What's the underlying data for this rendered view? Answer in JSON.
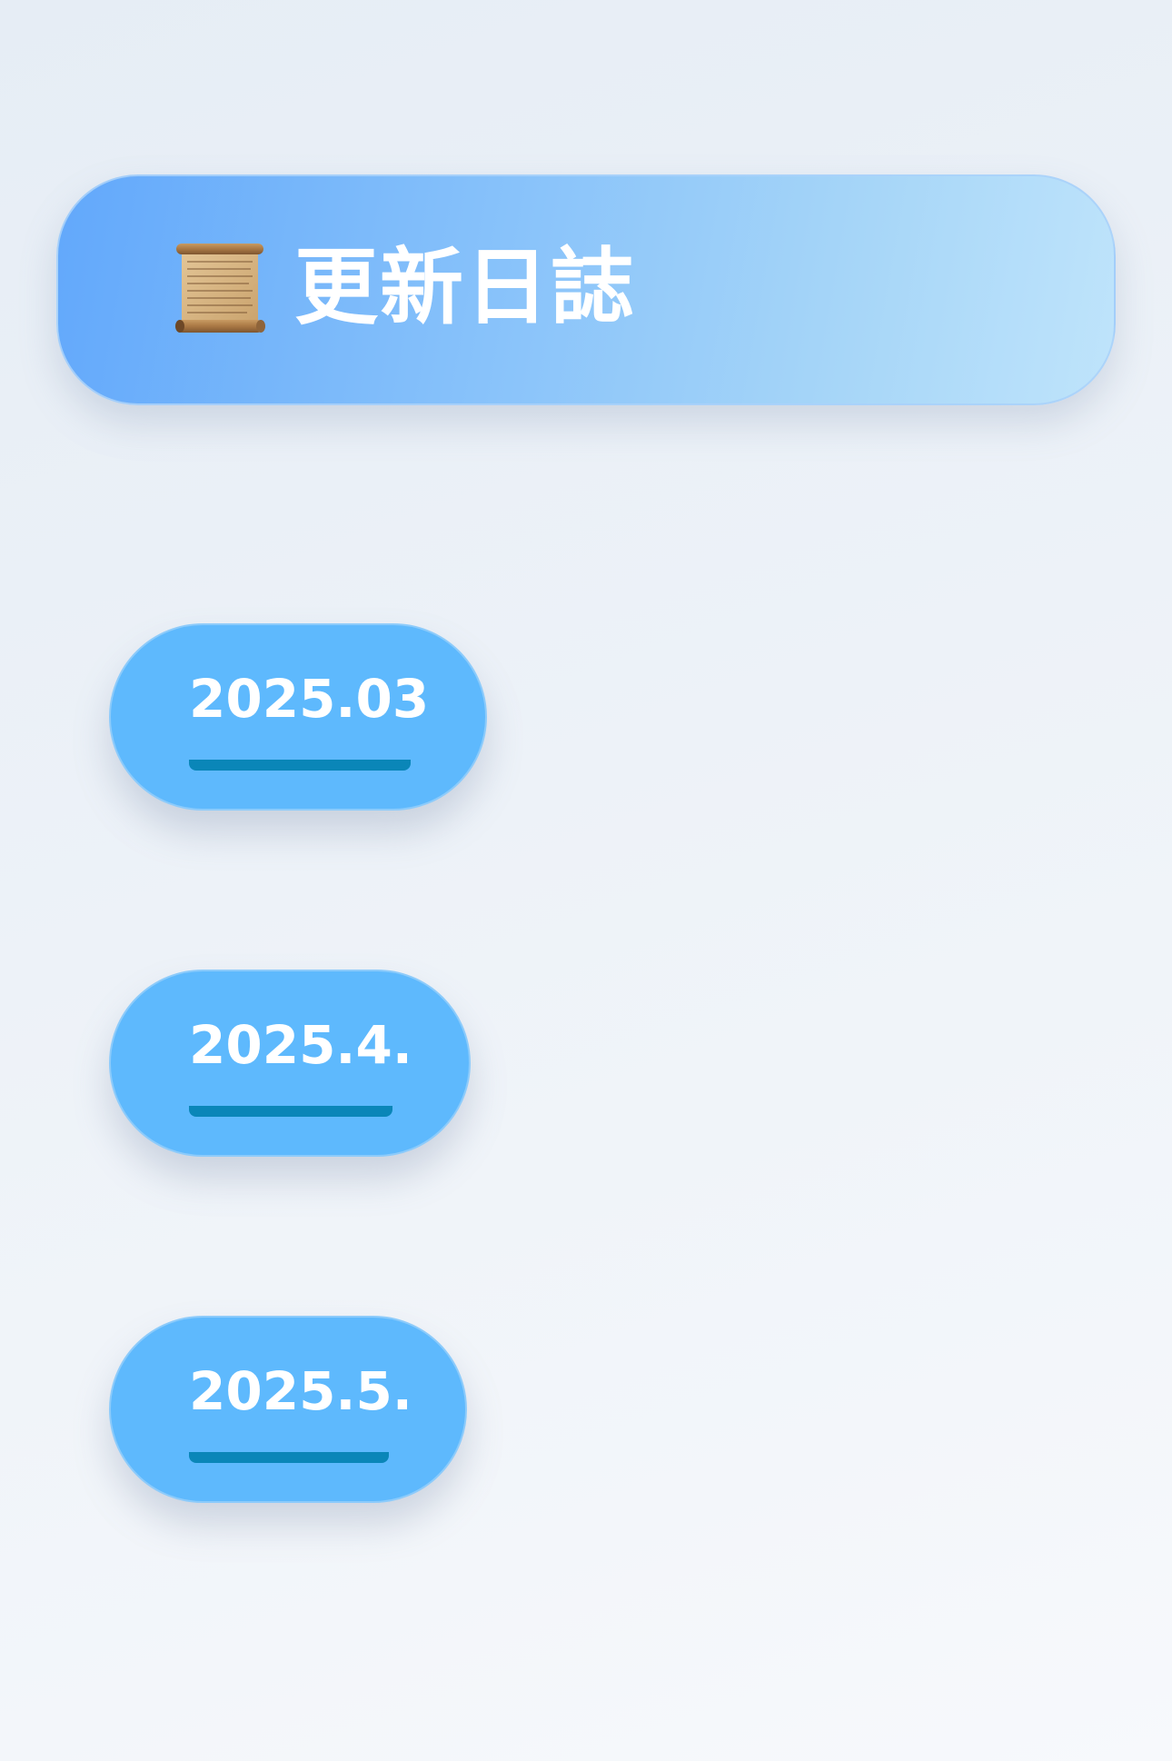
{
  "header": {
    "icon": "scroll-icon",
    "title": "更新日誌"
  },
  "versions": [
    {
      "label": "2025.03"
    },
    {
      "label": "2025.4."
    },
    {
      "label": "2025.5."
    }
  ],
  "colors": {
    "header_gradient_start": "#62a8fb",
    "header_gradient_end": "#bfe4fb",
    "pill_background": "#5eb9fd",
    "underline": "#0a86b8",
    "text": "#ffffff"
  }
}
